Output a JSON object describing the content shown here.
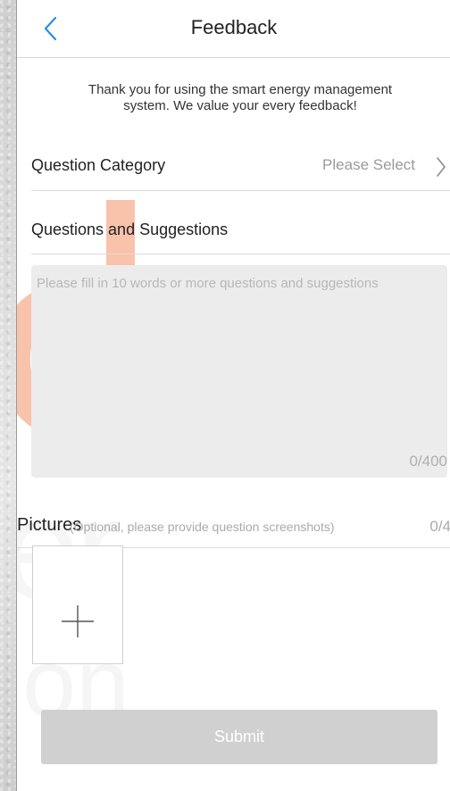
{
  "nav": {
    "back_icon": "chevron-left-icon",
    "title": "Feedback"
  },
  "intro": {
    "line1": "Thank you for using the smart energy management",
    "line2": "system. We value your every feedback!"
  },
  "category": {
    "label": "Question Category",
    "value": "Please Select",
    "chevron_icon": "chevron-right-icon"
  },
  "suggestions": {
    "label": "Questions and Suggestions",
    "placeholder": "Please fill in 10 words or more questions and suggestions",
    "value": "",
    "counter": "0/400"
  },
  "pictures": {
    "label": "Pictures",
    "hint": "(Optional, please provide question screenshots)",
    "count": "0/4",
    "add_icon": "plus-icon"
  },
  "submit": {
    "label": "Submit"
  },
  "colors": {
    "accent": "#2b8de8",
    "watermark_orange": "#f39a73",
    "submit_disabled": "#d0d0d0",
    "input_bg": "#ececec"
  }
}
